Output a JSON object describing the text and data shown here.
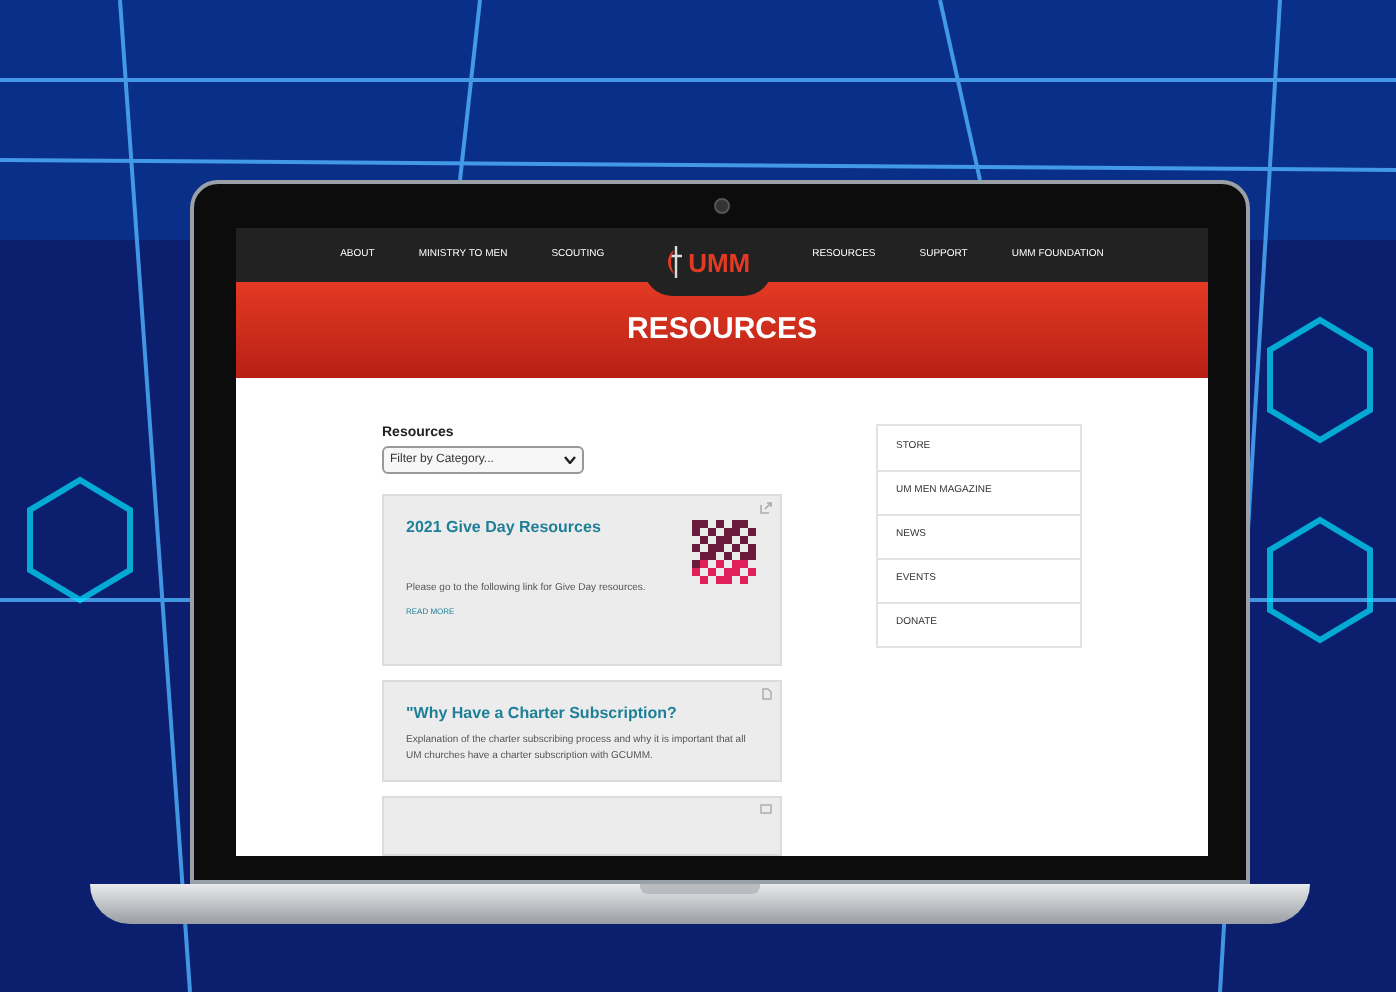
{
  "nav": {
    "left": [
      {
        "label": "ABOUT"
      },
      {
        "label": "MINISTRY TO MEN"
      },
      {
        "label": "SCOUTING"
      }
    ],
    "logo": "UMM",
    "right": [
      {
        "label": "RESOURCES"
      },
      {
        "label": "SUPPORT"
      },
      {
        "label": "UMM FOUNDATION"
      }
    ]
  },
  "banner": {
    "title": "RESOURCES"
  },
  "filter": {
    "label": "Resources",
    "value": "Filter by Category..."
  },
  "cards": [
    {
      "kind": "qr",
      "title": "2021 Give Day Resources",
      "text": "Please go to the following link for Give Day resources.",
      "link": "READ MORE"
    },
    {
      "kind": "doc",
      "title": "\"Why Have a Charter Subscription?",
      "text": "Explanation of the charter subscribing process and why it is important that all UM churches have a charter subscription with GCUMM."
    },
    {
      "kind": "video"
    }
  ],
  "sidebar": {
    "items": [
      {
        "label": "STORE"
      },
      {
        "label": "UM MEN MAGAZINE"
      },
      {
        "label": "NEWS"
      },
      {
        "label": "EVENTS"
      },
      {
        "label": "DONATE"
      }
    ]
  }
}
